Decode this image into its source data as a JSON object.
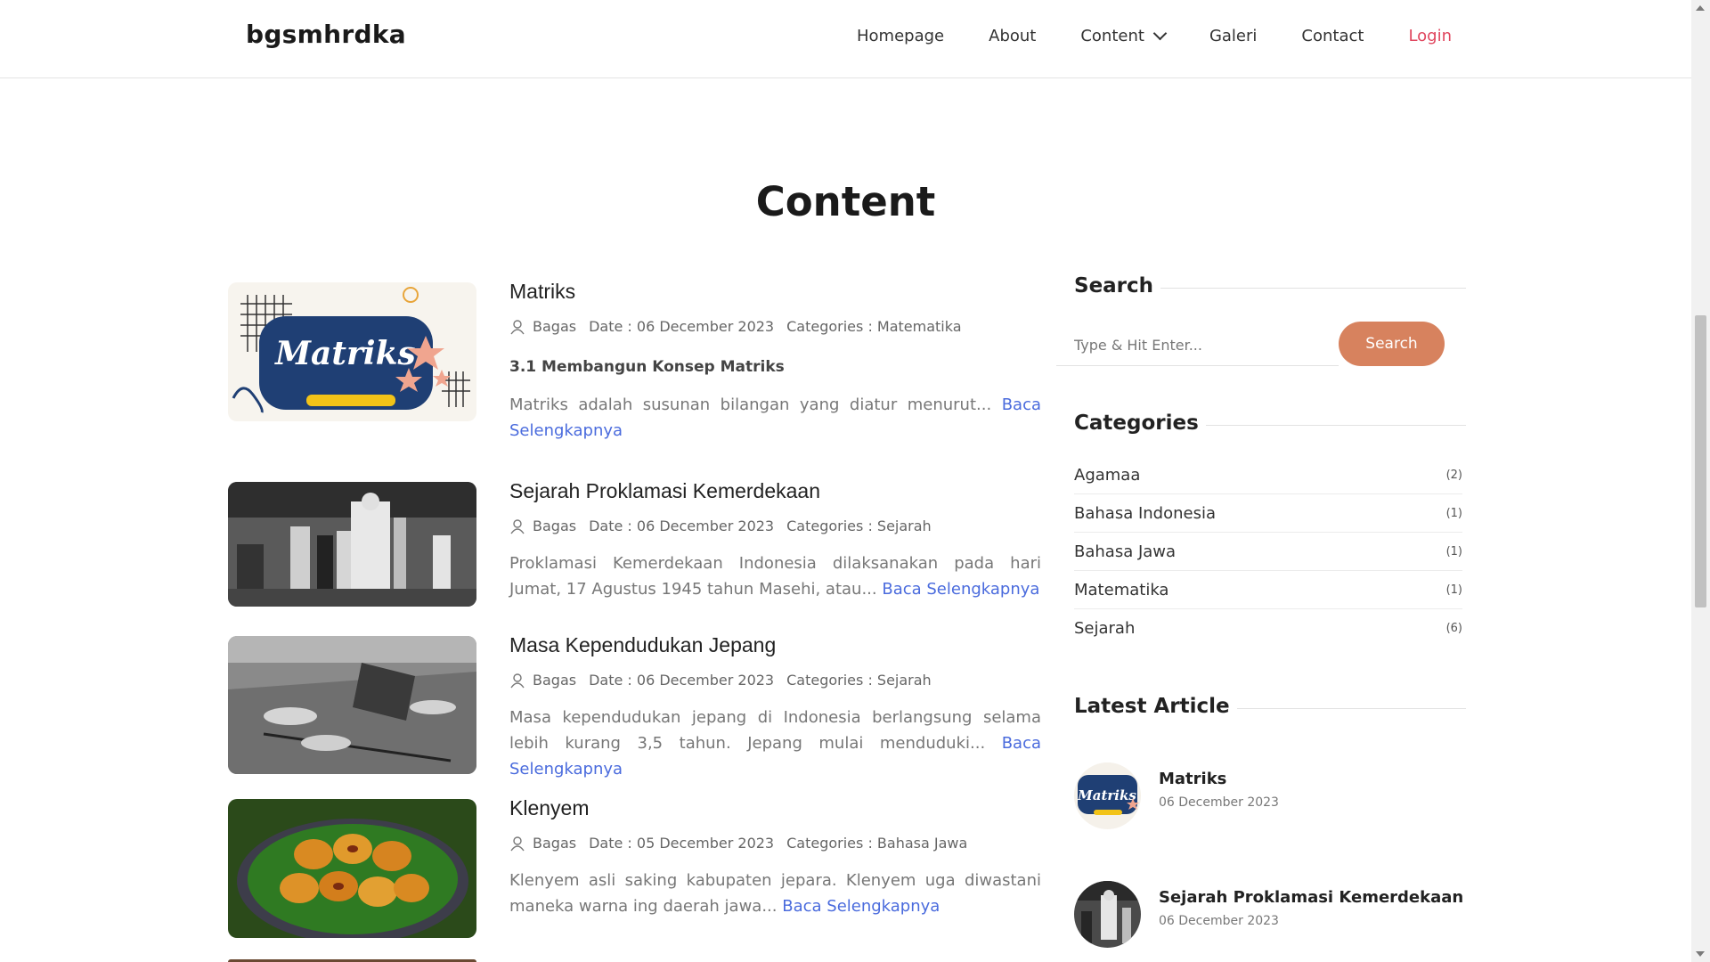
{
  "navbar": {
    "brand": "bgsmhrdka",
    "items": [
      {
        "label": "Homepage"
      },
      {
        "label": "About"
      },
      {
        "label": "Content"
      },
      {
        "label": "Galeri"
      },
      {
        "label": "Contact"
      }
    ],
    "login": "Login",
    "login_color": "#e0465e"
  },
  "page": {
    "title": "Content"
  },
  "articles": [
    {
      "title": "Matriks",
      "author": "Bagas",
      "date": "Date : 06 December 2023",
      "category": "Categories : Matematika",
      "subheading": "3.1 Membangun Konsep Matriks",
      "excerpt": "Matriks adalah susunan bilangan yang diatur menurut... ",
      "read_more": "Baca Selengkapnya",
      "thumb_text": "Matriks"
    },
    {
      "title": "Sejarah Proklamasi Kemerdekaan",
      "author": "Bagas",
      "date": "Date : 06 December 2023",
      "category": "Categories : Sejarah",
      "excerpt": "Proklamasi Kemerdekaan Indonesia dilaksanakan pada hari Jumat, 17 Agustus 1945 tahun Masehi, atau... ",
      "read_more": "Baca Selengkapnya"
    },
    {
      "title": "Masa Kependudukan Jepang",
      "author": "Bagas",
      "date": "Date : 06 December 2023",
      "category": "Categories : Sejarah",
      "excerpt": "Masa kependudukan jepang di Indonesia berlangsung selama lebih kurang 3,5 tahun. Jepang mulai menduduki... ",
      "read_more": "Baca Selengkapnya"
    },
    {
      "title": "Klenyem",
      "author": "Bagas",
      "date": "Date : 05 December 2023",
      "category": "Categories : Bahasa Jawa",
      "excerpt": "Klenyem asli saking kabupaten jepara. Klenyem uga diwastani maneka warna ing daerah jawa... ",
      "read_more": "Baca Selengkapnya"
    }
  ],
  "sidebar": {
    "search": {
      "heading": "Search",
      "placeholder": "Type & Hit Enter...",
      "button": "Search",
      "button_color": "#d7825e"
    },
    "categories": {
      "heading": "Categories",
      "items": [
        {
          "name": "Agamaa",
          "count": "(2)"
        },
        {
          "name": "Bahasa Indonesia",
          "count": "(1)"
        },
        {
          "name": "Bahasa Jawa",
          "count": "(1)"
        },
        {
          "name": "Matematika",
          "count": "(1)"
        },
        {
          "name": "Sejarah",
          "count": "(6)"
        }
      ]
    },
    "latest": {
      "heading": "Latest Article",
      "items": [
        {
          "title": "Matriks",
          "date": "06 December 2023",
          "thumb_text": "Matriks"
        },
        {
          "title": "Sejarah Proklamasi Kemerdekaan",
          "date": "06 December 2023"
        }
      ]
    }
  },
  "colors": {
    "link": "#4a6bdd",
    "matriks_navy": "#1f3f74"
  }
}
